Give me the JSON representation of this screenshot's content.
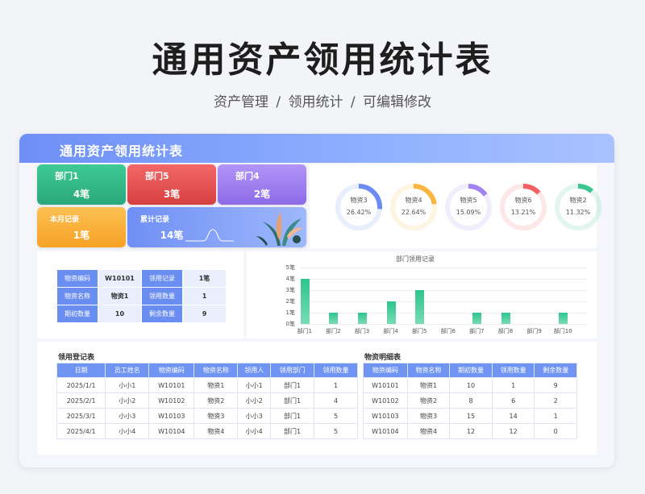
{
  "header": {
    "title": "通用资产领用统计表",
    "subtitle": "资产管理 /  领用统计 /  可编辑修改"
  },
  "card": {
    "title": "通用资产领用统计表"
  },
  "tiles": [
    {
      "name": "部门1",
      "value": "4笔",
      "color": "#2fbf88"
    },
    {
      "name": "部门5",
      "value": "3笔",
      "color": "#ee5151"
    },
    {
      "name": "部门4",
      "value": "2笔",
      "color": "#9f7ef2"
    },
    {
      "name": "本月记录",
      "value": "1笔",
      "color": "#fbb33a"
    },
    {
      "name": "累计记录",
      "value": "14笔",
      "color": "#6f8ff5"
    }
  ],
  "donuts": [
    {
      "name": "物资3",
      "value": "26.42%",
      "percent": 26.42,
      "color": "#6d8cf3"
    },
    {
      "name": "物资4",
      "value": "22.64%",
      "percent": 22.64,
      "color": "#f9b53f"
    },
    {
      "name": "物资5",
      "value": "15.09%",
      "percent": 15.09,
      "color": "#a283f0"
    },
    {
      "name": "物资6",
      "value": "13.21%",
      "percent": 13.21,
      "color": "#f16161"
    },
    {
      "name": "物资2",
      "value": "11.32%",
      "percent": 11.32,
      "color": "#3cc58f"
    }
  ],
  "info": {
    "rows": [
      [
        "物资编码",
        "W10101",
        "领用记录",
        "1笔"
      ],
      [
        "物资名称",
        "物资1",
        "领用数量",
        "1"
      ],
      [
        "期初数量",
        "10",
        "剩余数量",
        "9"
      ]
    ]
  },
  "chart_data": {
    "type": "bar",
    "title": "部门领用记录",
    "categories": [
      "部门1",
      "部门2",
      "部门3",
      "部门4",
      "部门5",
      "部门6",
      "部门7",
      "部门8",
      "部门9",
      "部门10"
    ],
    "values": [
      4,
      1,
      1,
      2,
      3,
      0,
      1,
      1,
      0,
      1
    ],
    "yticks": [
      "0笔",
      "1笔",
      "2笔",
      "3笔",
      "4笔",
      "5笔"
    ],
    "ylim": [
      0,
      5
    ],
    "grid": true
  },
  "register": {
    "title": "领用登记表",
    "columns": [
      "日期",
      "员工姓名",
      "物资编码",
      "物资名称",
      "领用人",
      "领用部门",
      "领用数量"
    ],
    "rows": [
      [
        "2025/1/1",
        "小小1",
        "W10101",
        "物资1",
        "小小1",
        "部门1",
        "1"
      ],
      [
        "2025/2/1",
        "小小2",
        "W10102",
        "物资2",
        "小小2",
        "部门1",
        "4"
      ],
      [
        "2025/3/1",
        "小小3",
        "W10103",
        "物资3",
        "小小3",
        "部门1",
        "5"
      ],
      [
        "2025/4/1",
        "小小4",
        "W10104",
        "物资4",
        "小小4",
        "部门1",
        "5"
      ]
    ]
  },
  "detail": {
    "title": "物资明细表",
    "columns": [
      "物资编码",
      "物资名称",
      "期初数量",
      "领用数量",
      "剩余数量"
    ],
    "rows": [
      [
        "W10101",
        "物资1",
        "10",
        "1",
        "9"
      ],
      [
        "W10102",
        "物资2",
        "8",
        "6",
        "2"
      ],
      [
        "W10103",
        "物资3",
        "15",
        "14",
        "1"
      ],
      [
        "W10104",
        "物资4",
        "12",
        "12",
        "0"
      ]
    ]
  }
}
